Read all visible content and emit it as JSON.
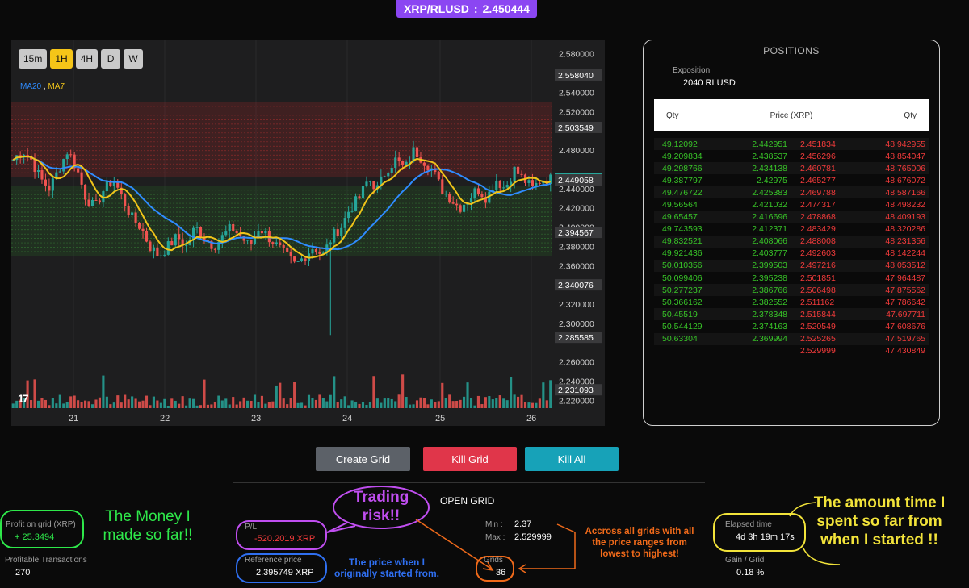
{
  "header": {
    "pair": "XRP/RLUSD",
    "separator": ":",
    "price": "2.450444"
  },
  "chart": {
    "timeframes": [
      "15m",
      "1H",
      "4H",
      "D",
      "W"
    ],
    "active_timeframe": "1H",
    "legend": {
      "ma20": "MA20",
      "sep": ",",
      "ma7": "MA7"
    },
    "logo": "17",
    "colors": {
      "up": "#26a69a",
      "down": "#ef5350",
      "ma20": "#2f8cff",
      "ma7": "#f0c419"
    }
  },
  "chart_data": {
    "type": "candlestick",
    "x_ticks": [
      "21",
      "22",
      "23",
      "24",
      "25",
      "26"
    ],
    "y_ticks": [
      "2.580000",
      "2.540000",
      "2.520000",
      "2.480000",
      "2.440000",
      "2.420000",
      "2.400000",
      "2.380000",
      "2.360000",
      "2.320000",
      "2.300000",
      "2.260000",
      "2.240000",
      "2.220000"
    ],
    "price_labels": [
      "2.558040",
      "2.503549",
      "2.450444",
      "2.449058",
      "2.394567",
      "2.340076",
      "2.285585",
      "2.231093"
    ],
    "current_price": "2.450444",
    "ylim": [
      2.212,
      2.594
    ],
    "grid_levels_sell_range": [
      2.451834,
      2.529999
    ],
    "grid_levels_buy_range": [
      2.369994,
      2.442951
    ],
    "close_path": [
      2.47,
      2.48,
      2.47,
      2.45,
      2.44,
      2.46,
      2.48,
      2.46,
      2.43,
      2.42,
      2.44,
      2.45,
      2.43,
      2.41,
      2.4,
      2.38,
      2.37,
      2.38,
      2.39,
      2.38,
      2.4,
      2.39,
      2.38,
      2.39,
      2.4,
      2.39,
      2.38,
      2.4,
      2.39,
      2.38,
      2.37,
      2.36,
      2.37,
      2.38,
      2.37,
      2.39,
      2.4,
      2.42,
      2.43,
      2.45,
      2.44,
      2.46,
      2.47,
      2.46,
      2.48,
      2.47,
      2.46,
      2.44,
      2.43,
      2.42,
      2.43,
      2.44,
      2.43,
      2.45,
      2.44,
      2.46,
      2.45,
      2.44,
      2.45,
      2.45
    ]
  },
  "positions": {
    "title": "POSITIONS",
    "exposition_label": "Exposition",
    "exposition_value": "2040 RLUSD",
    "headers": {
      "left": "Qty",
      "mid": "Price (XRP)",
      "right": "Qty"
    },
    "rows": [
      [
        "49.12092",
        "2.442951",
        "2.451834",
        "48.942955"
      ],
      [
        "49.209834",
        "2.438537",
        "2.456296",
        "48.854047"
      ],
      [
        "49.298766",
        "2.434138",
        "2.460781",
        "48.765006"
      ],
      [
        "49.387797",
        "2.42975",
        "2.465277",
        "48.676072"
      ],
      [
        "49.476722",
        "2.425383",
        "2.469788",
        "48.587166"
      ],
      [
        "49.56564",
        "2.421032",
        "2.474317",
        "48.498232"
      ],
      [
        "49.65457",
        "2.416696",
        "2.478868",
        "48.409193"
      ],
      [
        "49.743593",
        "2.412371",
        "2.483429",
        "48.320286"
      ],
      [
        "49.832521",
        "2.408066",
        "2.488008",
        "48.231356"
      ],
      [
        "49.921436",
        "2.403777",
        "2.492603",
        "48.142244"
      ],
      [
        "50.010356",
        "2.399503",
        "2.497216",
        "48.053512"
      ],
      [
        "50.099406",
        "2.395238",
        "2.501851",
        "47.964487"
      ],
      [
        "50.277237",
        "2.386766",
        "2.506498",
        "47.875562"
      ],
      [
        "50.366162",
        "2.382552",
        "2.511162",
        "47.786642"
      ],
      [
        "50.45519",
        "2.378348",
        "2.515844",
        "47.697711"
      ],
      [
        "50.544129",
        "2.374163",
        "2.520549",
        "47.608676"
      ],
      [
        "50.63304",
        "2.369994",
        "2.525265",
        "47.519765"
      ],
      [
        "",
        "",
        "2.529999",
        "47.430849"
      ]
    ]
  },
  "actions": {
    "create": "Create Grid",
    "kill": "Kill Grid",
    "kill_all": "Kill All"
  },
  "stats": {
    "profit_label": "Profit on grid (XRP)",
    "profit_value": "+ 25.3494",
    "profitable_tx_label": "Profitable Transactions",
    "profitable_tx_value": "270",
    "pl_label": "P/L",
    "pl_value": "-520.2019 XRP",
    "ref_label": "Reference price",
    "ref_value": "2.395749 XRP",
    "open_grid_title": "OPEN GRID",
    "min_label": "Min :",
    "min_value": "2.37",
    "max_label": "Max :",
    "max_value": "2.529999",
    "grids_label": "Grids",
    "grids_value": "36",
    "elapsed_label": "Elapsed time",
    "elapsed_value": "4d 3h 19m 17s",
    "gain_label": "Gain / Grid",
    "gain_value": "0.18 %"
  },
  "annotations": {
    "money": "The Money I made so far!!",
    "risk": "Trading risk!!",
    "price_start": "The price when I originally started from.",
    "ranges": "Accross all grids with all the price ranges from lowest to highest!",
    "time": "The amount time I spent so far from when I started !!",
    "colors": {
      "green": "#2ee84a",
      "purple": "#c04ef0",
      "blue": "#2f6ff0",
      "orange": "#f06a1a",
      "yellow": "#f2e33a"
    }
  }
}
